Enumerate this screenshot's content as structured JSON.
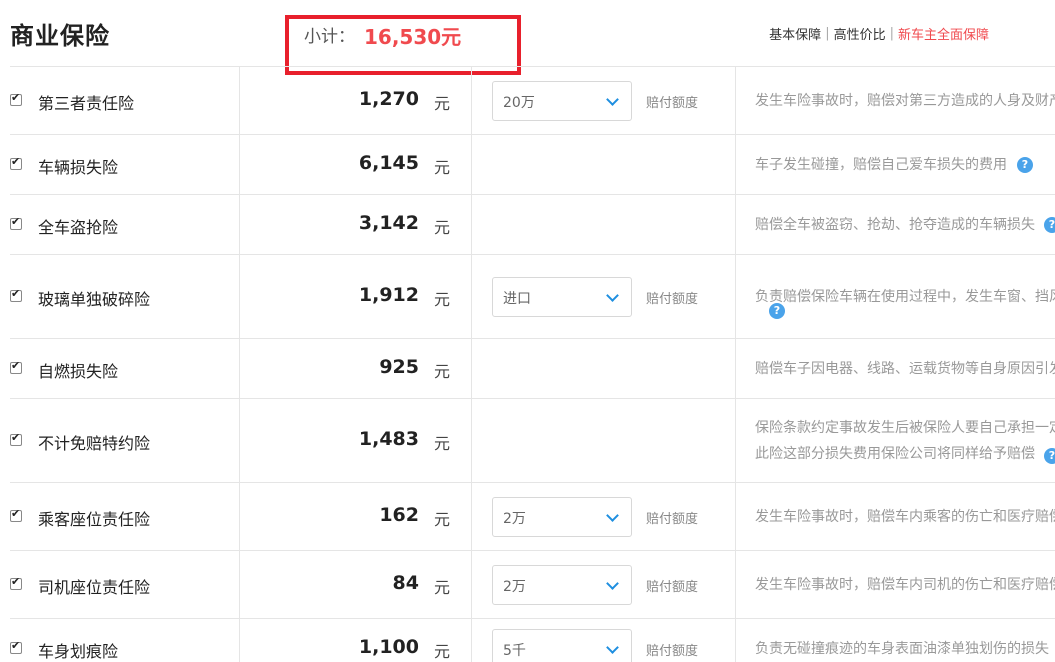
{
  "header": {
    "title": "商业保险",
    "subtotal_label": "小计：",
    "subtotal_value": "16,530元",
    "links": [
      "基本保障",
      "高性价比",
      "新车主全面保障"
    ],
    "separator": "|"
  },
  "unit": "元",
  "amount_label": "赔付额度",
  "help_icon": "question-circle-icon",
  "colors": {
    "accent_red": "#f04a4e",
    "box_red": "#e8202c",
    "help_blue": "#4aa3ea"
  },
  "rows": [
    {
      "name": "第三者责任险",
      "price": "1,270",
      "select": "20万",
      "desc": [
        "发生车险事故时，赔偿对第三方造成的人身及财产"
      ]
    },
    {
      "name": "车辆损失险",
      "price": "6,145",
      "select": null,
      "desc": [
        "车子发生碰撞，赔偿自己爱车损失的费用"
      ]
    },
    {
      "name": "全车盗抢险",
      "price": "3,142",
      "select": null,
      "desc": [
        "赔偿全车被盗窃、抢劫、抢夺造成的车辆损失"
      ]
    },
    {
      "name": "玻璃单独破碎险",
      "price": "1,912",
      "select": "进口",
      "desc": [
        "负责赔偿保险车辆在使用过程中，发生车窗、挡风"
      ]
    },
    {
      "name": "自燃损失险",
      "price": "925",
      "select": null,
      "desc": [
        "赔偿车子因电器、线路、运载货物等自身原因引发"
      ]
    },
    {
      "name": "不计免赔特约险",
      "price": "1,483",
      "select": null,
      "desc": [
        "保险条款约定事故发生后被保险人要自己承担一定",
        "此险这部分损失费用保险公司将同样给予赔偿"
      ]
    },
    {
      "name": "乘客座位责任险",
      "price": "162",
      "select": "2万",
      "desc": [
        "发生车险事故时，赔偿车内乘客的伤亡和医疗赔偿"
      ]
    },
    {
      "name": "司机座位责任险",
      "price": "84",
      "select": "2万",
      "desc": [
        "发生车险事故时，赔偿车内司机的伤亡和医疗赔偿"
      ]
    },
    {
      "name": "车身划痕险",
      "price": "1,100",
      "select": "5千",
      "desc": [
        "负责无碰撞痕迹的车身表面油漆单独划伤的损失"
      ]
    }
  ]
}
